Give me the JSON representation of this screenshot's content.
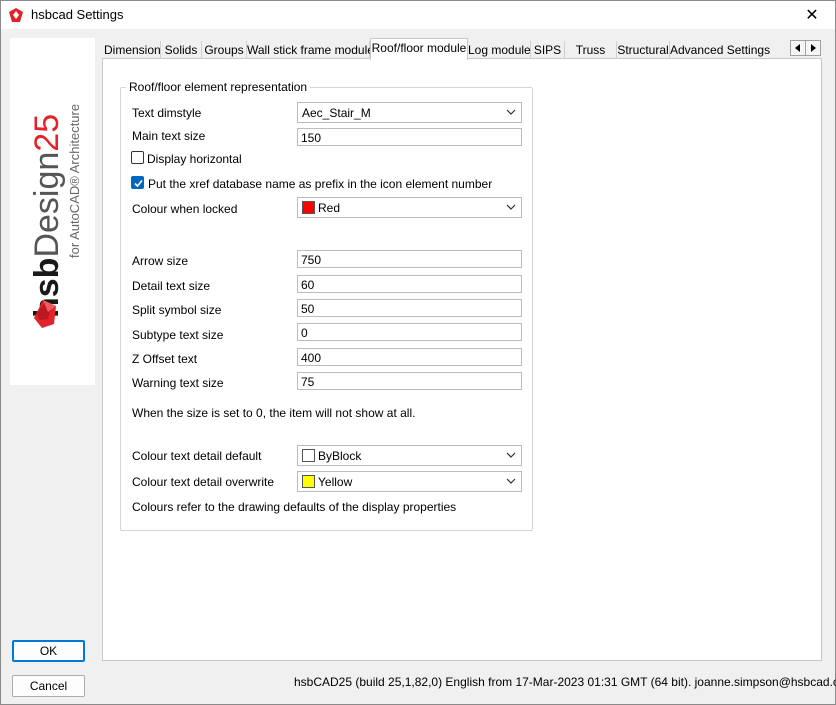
{
  "window": {
    "title": "hsbcad Settings",
    "close_glyph": "✕"
  },
  "branding": {
    "brand_bold": "hsb",
    "brand_light": "Design",
    "version": "25",
    "subtitle": "for AutoCAD® Architecture",
    "accent_color": "#e2232a"
  },
  "buttons": {
    "ok": "OK",
    "cancel": "Cancel"
  },
  "tabs": [
    {
      "label": "Dimension"
    },
    {
      "label": "Solids"
    },
    {
      "label": "Groups"
    },
    {
      "label": "Wall stick frame module"
    },
    {
      "label": "Roof/floor module",
      "active": true
    },
    {
      "label": "Log module"
    },
    {
      "label": "SIPS"
    },
    {
      "label": "Truss"
    },
    {
      "label": "Structural"
    },
    {
      "label": "Advanced Settings"
    }
  ],
  "group": {
    "title": "Roof/floor element representation",
    "text_dimstyle": {
      "label": "Text dimstyle",
      "value": "Aec_Stair_M"
    },
    "main_text_size": {
      "label": "Main text size",
      "value": "150"
    },
    "display_horizontal": {
      "label": "Display horizontal",
      "checked": false
    },
    "xref_prefix": {
      "label": "Put the xref database name as prefix in the icon element number",
      "checked": true
    },
    "colour_locked": {
      "label": "Colour when locked",
      "value": "Red",
      "swatch": "#ff0000"
    },
    "arrow_size": {
      "label": "Arrow size",
      "value": "750"
    },
    "detail_text_size": {
      "label": "Detail text size",
      "value": "60"
    },
    "split_symbol_size": {
      "label": "Split symbol size",
      "value": "50"
    },
    "subtype_text_size": {
      "label": "Subtype text size",
      "value": "0"
    },
    "z_offset_text": {
      "label": "Z Offset text",
      "value": "400"
    },
    "warning_text_size": {
      "label": "Warning text size",
      "value": "75"
    },
    "size_note": "When the size is set to 0, the item will not show at all.",
    "colour_detail_default": {
      "label": "Colour text detail default",
      "value": "ByBlock",
      "swatch": "#ffffff"
    },
    "colour_detail_overwrite": {
      "label": "Colour text detail overwrite",
      "value": "Yellow",
      "swatch": "#ffff00"
    },
    "colours_note": "Colours refer to the drawing defaults of the display properties"
  },
  "status_bar": {
    "text": "hsbCAD25 (build 25,1,82,0) English from 17-Mar-2023 01:31 GMT (64 bit). joanne.simpson@hsbcad.com"
  }
}
